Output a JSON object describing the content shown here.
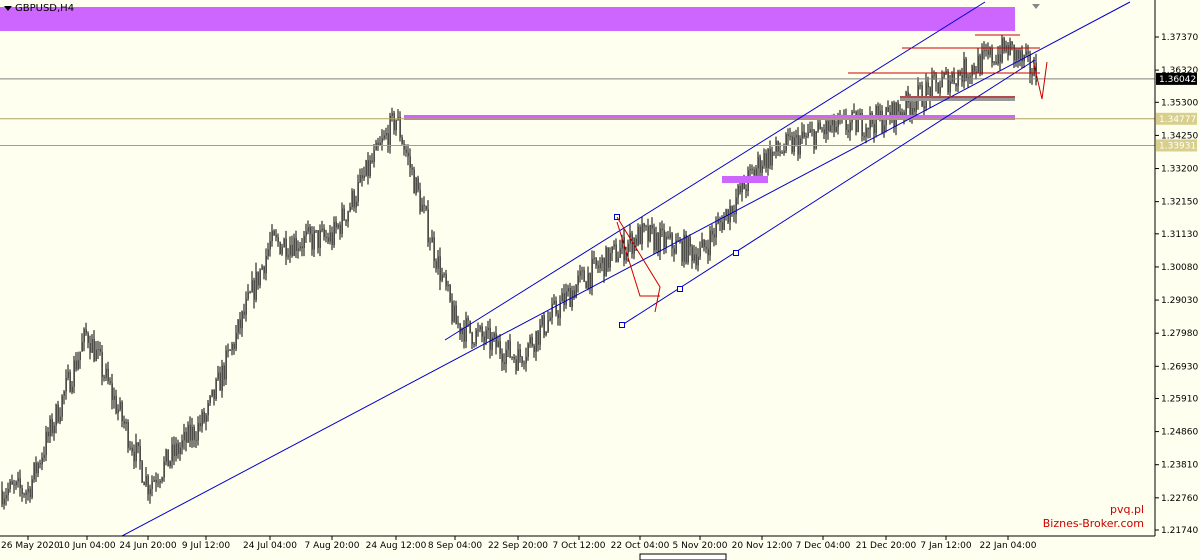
{
  "chart": {
    "symbol_label": "GBPUSD,H4",
    "colors": {
      "background": "#fffff0",
      "candles": "#000000",
      "channel": "#0000cc",
      "zone": "#cc66ff",
      "box": "#999999",
      "level": "#cc0000",
      "hline_current": "#808080",
      "hline_level": "#b0a060"
    }
  },
  "price_axis": {
    "ticks": [
      "1.37370",
      "1.36320",
      "1.35300",
      "1.34250",
      "1.33200",
      "1.32150",
      "1.31130",
      "1.30080",
      "1.29030",
      "1.27980",
      "1.26930",
      "1.25910",
      "1.24860",
      "1.23810",
      "1.22760",
      "1.21740"
    ],
    "price_tags": [
      {
        "name": "price-tag-current",
        "text": "1.36042",
        "value": 1.36042,
        "bg": "#000000",
        "fg": "#ffffff"
      },
      {
        "name": "price-tag-level-1",
        "text": "1.34777",
        "value": 1.34777,
        "bg": "#d8cf8c",
        "fg": "#ffffff"
      },
      {
        "name": "price-tag-level-2",
        "text": "1.33931",
        "value": 1.33931,
        "bg": "#d8cf8c",
        "fg": "#ffffff"
      }
    ]
  },
  "time_axis": {
    "labels": [
      "26 May 2020",
      "10 Jun 04:00",
      "24 Jun 20:00",
      "9 Jul 12:00",
      "24 Jul 04:00",
      "7 Aug 20:00",
      "24 Aug 12:00",
      "8 Sep 04:00",
      "22 Sep 20:00",
      "7 Oct 12:00",
      "22 Oct 04:00",
      "5 Nov 20:00",
      "20 Nov 12:00",
      "7 Dec 04:00",
      "21 Dec 20:00",
      "7 Jan 12:00",
      "22 Jan 04:00"
    ]
  },
  "watermark": {
    "line1": "pvq.pl",
    "line2": "Biznes-Broker.com"
  },
  "chart_data": {
    "type": "candlestick",
    "symbol": "GBPUSD",
    "timeframe": "H4",
    "ylim": [
      1.2174,
      1.3737
    ],
    "current_price": 1.36042,
    "levels": [
      1.34777,
      1.33931
    ],
    "anchors": [
      {
        "x": "26 May 2020",
        "y": 1.23
      },
      {
        "x": "10 Jun 04:00",
        "y": 1.28
      },
      {
        "x": "24 Jun 20:00",
        "y": 1.232
      },
      {
        "x": "9 Jul 12:00",
        "y": 1.253
      },
      {
        "x": "24 Jul 04:00",
        "y": 1.308
      },
      {
        "x": "7 Aug 20:00",
        "y": 1.31
      },
      {
        "x": "24 Aug 12:00",
        "y": 1.348
      },
      {
        "x": "8 Sep 04:00",
        "y": 1.283
      },
      {
        "x": "22 Sep 20:00",
        "y": 1.272
      },
      {
        "x": "7 Oct 12:00",
        "y": 1.296
      },
      {
        "x": "22 Oct 04:00",
        "y": 1.311
      },
      {
        "x": "5 Nov 20:00",
        "y": 1.305
      },
      {
        "x": "20 Nov 12:00",
        "y": 1.335
      },
      {
        "x": "7 Dec 04:00",
        "y": 1.344
      },
      {
        "x": "21 Dec 20:00",
        "y": 1.348
      },
      {
        "x": "7 Jan 12:00",
        "y": 1.36
      },
      {
        "x": "22 Jan 04:00",
        "y": 1.37
      }
    ]
  }
}
